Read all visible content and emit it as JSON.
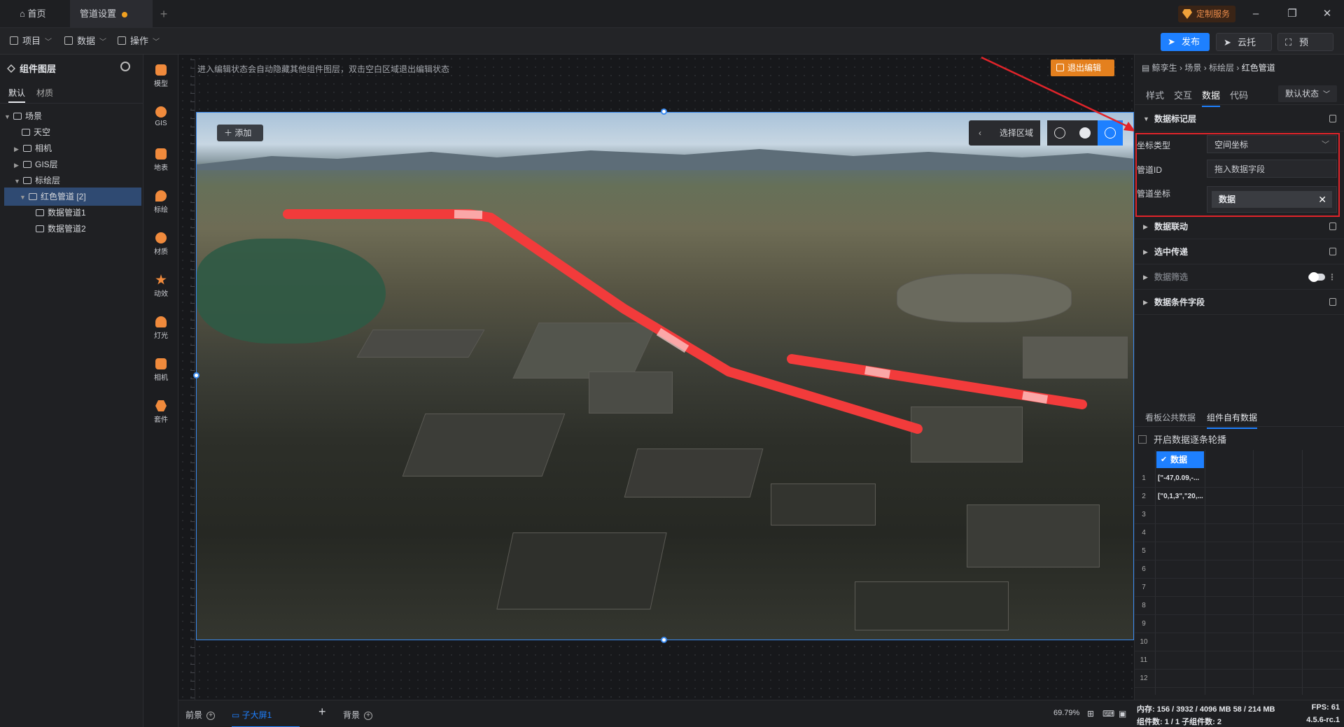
{
  "titlebar": {
    "tabs": [
      "首页",
      "管道设置"
    ],
    "custom_service": "定制服务"
  },
  "menubar": {
    "items": [
      "项目",
      "数据",
      "操作"
    ],
    "publish": "发布",
    "cloud": "云托管",
    "preview": "预览"
  },
  "layer_panel": {
    "title": "组件图层",
    "tabs": [
      "默认",
      "材质"
    ],
    "tree": [
      "场景",
      "天空",
      "相机",
      "GIS层",
      "标绘层",
      "红色管道 [2]",
      "数据管道1",
      "数据管道2"
    ]
  },
  "tools": [
    "模型",
    "GIS",
    "地表",
    "标绘",
    "材质",
    "动效",
    "灯光",
    "相机",
    "套件"
  ],
  "canvas": {
    "hint": "进入编辑状态会自动隐藏其他组件图层，双击空白区域退出编辑状态",
    "exit_edit": "退出编辑",
    "add": "添加",
    "select_area": "选择区域"
  },
  "right_panel": {
    "breadcrumb": [
      "鲸孪生",
      "场景",
      "标绘层",
      "红色管道"
    ],
    "tabs": [
      "样式",
      "交互",
      "数据",
      "代码"
    ],
    "state": "默认状态",
    "sections": [
      "数据标记层",
      "数据联动",
      "选中传递",
      "数据筛选",
      "数据条件字段"
    ],
    "fields": {
      "coord_type_label": "坐标类型",
      "coord_type_value": "空间坐标",
      "pipe_id_label": "管道ID",
      "pipe_id_placeholder": "拖入数据字段",
      "pipe_coord_label": "管道坐标",
      "pipe_coord_value": "数据"
    },
    "data_tabs": [
      "看板公共数据",
      "组件自有数据"
    ],
    "carousel_label": "开启数据逐条轮播",
    "grid_header": "数据",
    "rows": [
      "[\"-47,0.09,-...",
      "[\"0,1,3\",\"20,..."
    ],
    "row_numbers": [
      "1",
      "2",
      "3",
      "4",
      "5",
      "6",
      "7",
      "8",
      "9",
      "10",
      "11",
      "12"
    ]
  },
  "bottom": {
    "tabs": [
      "前景",
      "子大屏1",
      "背景"
    ],
    "zoom": "69.79%",
    "memory": "内存: 156 / 3932 / 4096 MB  58 / 214 MB",
    "fps": "FPS: 61",
    "components": "组件数: 1 / 1   子组件数: 2",
    "version": "4.5.6-rc.1"
  },
  "colors": {
    "accent": "#1e80ff",
    "pipe": "#f23b3b",
    "highlight": "#e0242a",
    "exit": "#e4801e"
  }
}
